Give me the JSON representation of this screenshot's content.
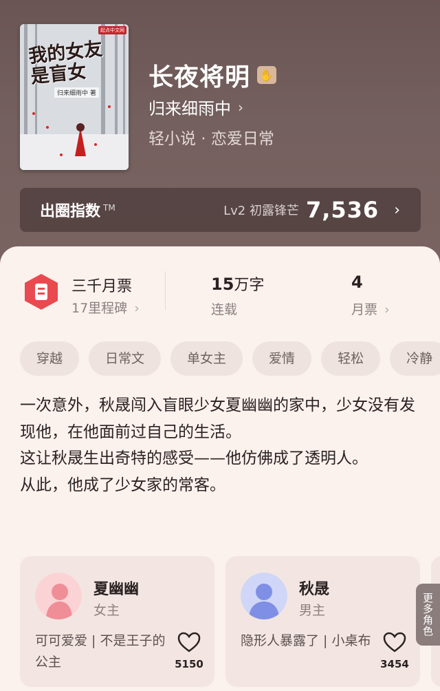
{
  "book": {
    "cover_title": "我的女友是盲女",
    "cover_author": "归来细雨中 著",
    "cover_publisher": "起点中文网",
    "title": "长夜将明",
    "author": "归来细雨中",
    "genre": "轻小说 · 恋爱日常"
  },
  "index_bar": {
    "label": "出圈指数",
    "tm": "TM",
    "level": "Lv2 初露锋芒",
    "value": "7,536"
  },
  "stats": {
    "milestone_title": "三千月票",
    "milestone_sub": "17里程碑",
    "words_num": "15",
    "words_unit": "万字",
    "status": "连载",
    "tickets_num": "4",
    "tickets_label": "月票"
  },
  "tags": [
    "穿越",
    "日常文",
    "单女主",
    "爱情",
    "轻松",
    "冷静"
  ],
  "description": [
    "一次意外，秋晟闯入盲眼少女夏幽幽的家中，少女没有发现他，在他面前过自己的生活。",
    "这让秋晟生出奇特的感受——他仿佛成了透明人。",
    "从此，他成了少女家的常客。"
  ],
  "characters": [
    {
      "name": "夏幽幽",
      "role": "女主",
      "desc": "可可爱爱 | 不是王子的公主",
      "likes": "5150",
      "color": "#f2a5ad"
    },
    {
      "name": "秋晟",
      "role": "男主",
      "desc": "隐形人暴露了 | 小桌布",
      "likes": "3454",
      "color": "#8e9ce8"
    }
  ],
  "more_roles": "更多角色",
  "colors": {
    "accent": "#e84a4f",
    "panel": "#fbf1ed",
    "hero": "#6e5a59"
  }
}
